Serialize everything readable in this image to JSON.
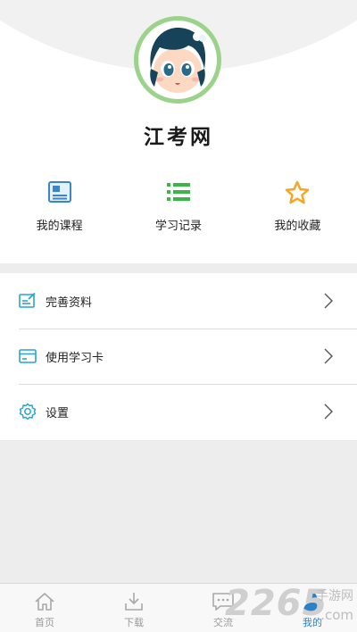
{
  "profile": {
    "app_name": "江考网"
  },
  "quick_actions": [
    {
      "label": "我的课程",
      "icon": "course-icon"
    },
    {
      "label": "学习记录",
      "icon": "list-icon"
    },
    {
      "label": "我的收藏",
      "icon": "star-icon"
    }
  ],
  "menu": [
    {
      "label": "完善资料",
      "icon": "edit-profile-icon"
    },
    {
      "label": "使用学习卡",
      "icon": "card-icon"
    },
    {
      "label": "设置",
      "icon": "gear-icon"
    }
  ],
  "tabbar": [
    {
      "label": "首页",
      "icon": "home-icon"
    },
    {
      "label": "下载",
      "icon": "download-icon"
    },
    {
      "label": "交流",
      "icon": "chat-icon"
    },
    {
      "label": "我的",
      "icon": "user-icon",
      "active": true
    }
  ],
  "watermark": {
    "number": "2265",
    "text": "手游网",
    "domain": ".com"
  },
  "colors": {
    "accent": "#2b82c9",
    "list_icon_green": "#39b54a",
    "star_orange": "#f5a623",
    "menu_icon_teal": "#29a3d1",
    "avatar_ring": "#9bd38a",
    "background": "#ededed"
  }
}
